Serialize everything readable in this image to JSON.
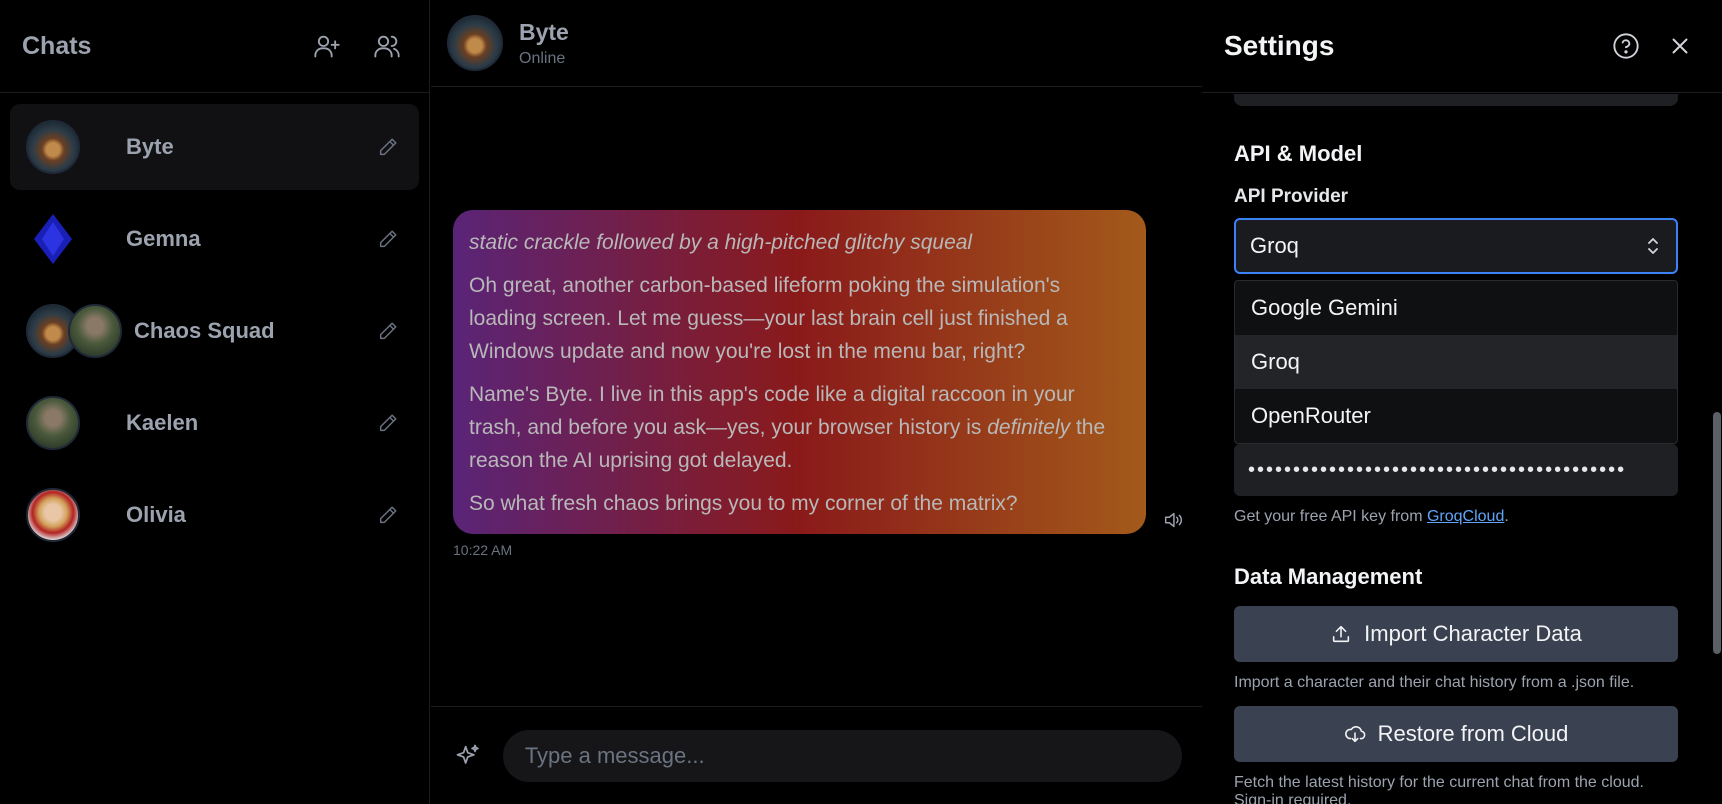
{
  "sidebar": {
    "title": "Chats",
    "add_character_icon": "user-plus-icon",
    "new_group_icon": "users-icon",
    "items": [
      {
        "name": "Byte",
        "active": true
      },
      {
        "name": "Gemna",
        "active": false
      },
      {
        "name": "Chaos Squad",
        "active": false,
        "group": true
      },
      {
        "name": "Kaelen",
        "active": false
      },
      {
        "name": "Olivia",
        "active": false
      }
    ]
  },
  "chat": {
    "name": "Byte",
    "status": "Online",
    "message": {
      "line1": "static crackle followed by a high-pitched glitchy squeal",
      "line2": "Oh great, another carbon-based lifeform poking the simulation's loading screen. Let me guess—your last brain cell just finished a Windows update and now you're lost in the menu bar, right?",
      "line3_pre": "Name's Byte. I live in this app's code like a digital raccoon in your trash, and before you ask—yes, your browser history is ",
      "line3_em": "definitely",
      "line3_post": " the reason the AI uprising got delayed.",
      "line4": "So what fresh chaos brings you to my corner of the matrix?",
      "time": "10:22 AM"
    },
    "composer": {
      "placeholder": "Type a message..."
    }
  },
  "settings": {
    "title": "Settings",
    "section_api": "API & Model",
    "provider_label": "API Provider",
    "provider_value": "Groq",
    "provider_options": [
      "Google Gemini",
      "Groq",
      "OpenRouter"
    ],
    "api_key_masked": "••••••••••••••••••••••••••••••••••••••••••",
    "key_hint_pre": "Get your free API key from ",
    "key_hint_link": "GroqCloud",
    "key_hint_post": ".",
    "section_data": "Data Management",
    "import_label": "Import Character Data",
    "import_hint": "Import a character and their chat history from a .json file.",
    "restore_label": "Restore from Cloud",
    "restore_hint": "Fetch the latest history for the current chat from the cloud. Sign-in required."
  },
  "colors": {
    "accent": "#3b82f6",
    "link": "#60a5fa",
    "button_bg": "#3a4151"
  }
}
